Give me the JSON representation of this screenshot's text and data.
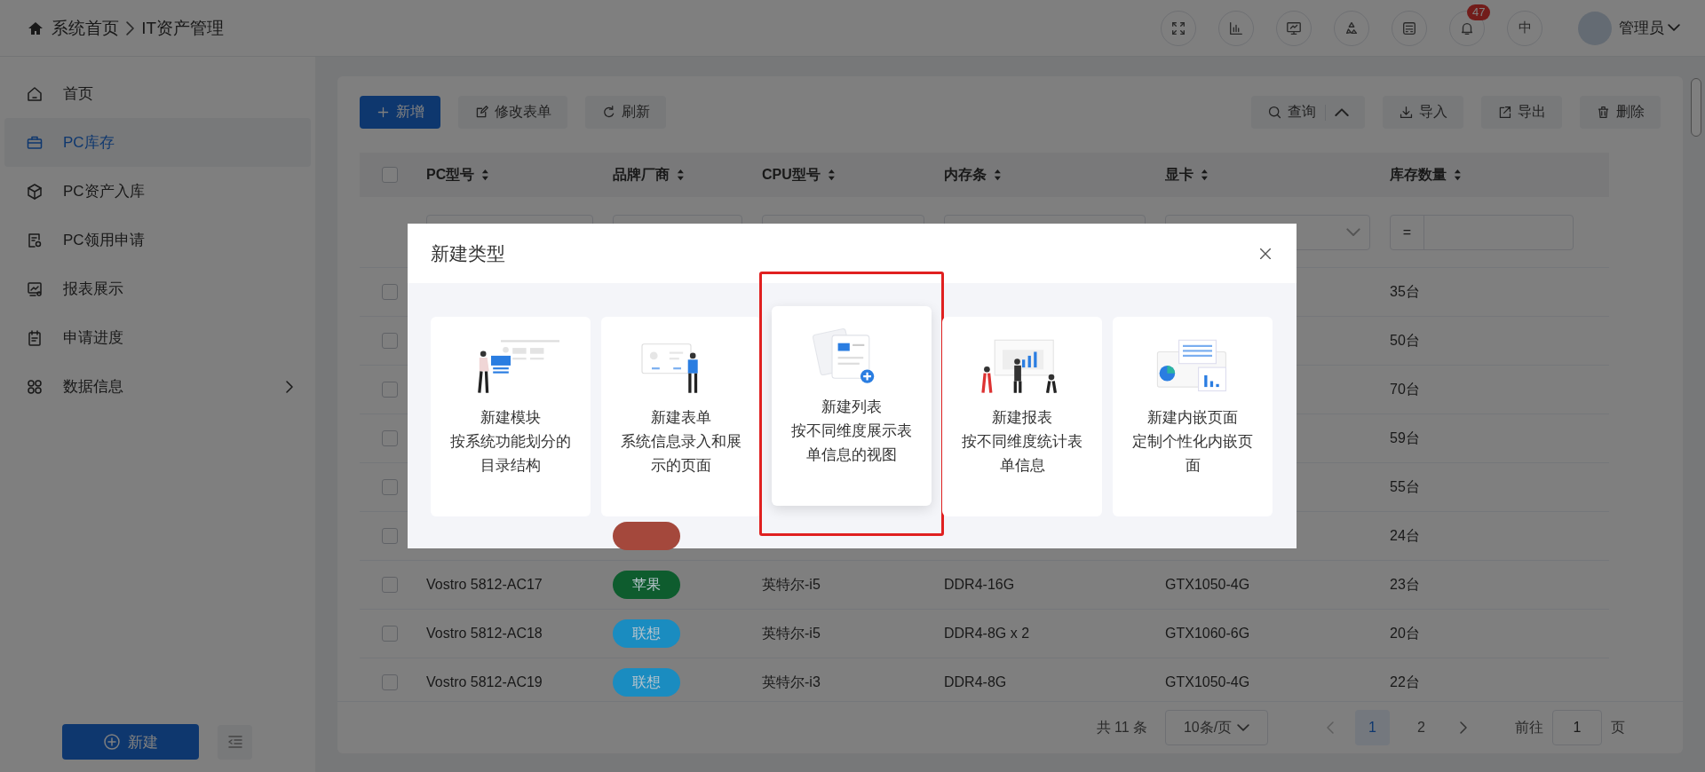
{
  "topbar": {
    "breadcrumb": [
      "系统首页",
      "IT资产管理"
    ],
    "tools": [
      {
        "kind": "fullscreen"
      },
      {
        "kind": "chart"
      },
      {
        "kind": "monitor"
      },
      {
        "kind": "cycle"
      },
      {
        "kind": "calc"
      },
      {
        "kind": "bell",
        "badge": "47"
      },
      {
        "kind": "lang",
        "label": "中"
      }
    ],
    "user": {
      "name": "管理员"
    }
  },
  "sidebar": {
    "items": [
      {
        "label": "首页",
        "kind": "home",
        "selected": false,
        "expandable": false
      },
      {
        "label": "PC库存",
        "kind": "case",
        "selected": true,
        "expandable": false
      },
      {
        "label": "PC资产入库",
        "kind": "cube",
        "selected": false,
        "expandable": false
      },
      {
        "label": "PC领用申请",
        "kind": "doc",
        "selected": false,
        "expandable": false
      },
      {
        "label": "报表展示",
        "kind": "report",
        "selected": false,
        "expandable": false
      },
      {
        "label": "申请进度",
        "kind": "clip",
        "selected": false,
        "expandable": false
      },
      {
        "label": "数据信息",
        "kind": "grid",
        "selected": false,
        "expandable": true
      }
    ],
    "new_button": "新建"
  },
  "toolbar": {
    "left": [
      {
        "label": "新增",
        "kind": "add",
        "primary": true
      },
      {
        "label": "修改表单",
        "kind": "edit",
        "primary": false
      },
      {
        "label": "刷新",
        "kind": "refresh",
        "primary": false
      }
    ],
    "right": [
      {
        "label": "查询",
        "kind": "query",
        "primary": false
      },
      {
        "label": "导入",
        "kind": "import",
        "primary": false
      },
      {
        "label": "导出",
        "kind": "export",
        "primary": false
      },
      {
        "label": "删除",
        "kind": "delete",
        "primary": false
      }
    ]
  },
  "table": {
    "all_checked": false,
    "columns": [
      {
        "label": "PC型号"
      },
      {
        "label": "品牌厂商"
      },
      {
        "label": "CPU型号"
      },
      {
        "label": "内存条"
      },
      {
        "label": "显卡"
      },
      {
        "label": "库存数量"
      }
    ],
    "filters": [
      {
        "kind": "text"
      },
      {
        "kind": "text"
      },
      {
        "kind": "text"
      },
      {
        "kind": "text"
      },
      {
        "kind": "select"
      },
      {
        "kind": "compare",
        "operator": "="
      }
    ],
    "rows": [
      {
        "checked": false,
        "qty": "35台"
      },
      {
        "checked": false,
        "qty": "50台"
      },
      {
        "checked": false,
        "qty": "70台"
      },
      {
        "checked": false,
        "qty": "59台"
      },
      {
        "checked": false,
        "qty": "55台"
      },
      {
        "checked": false,
        "brand": {
          "color": "#a4483c"
        },
        "qty": "24台"
      },
      {
        "checked": false,
        "model": "Vostro 5812-AC17",
        "brand": {
          "label": "苹果",
          "color": "#0e5c2e"
        },
        "cpu": "英特尔-i5",
        "memory": "DDR4-16G",
        "gpu": "GTX1050-4G",
        "qty": "23台"
      },
      {
        "checked": false,
        "model": "Vostro 5812-AC18",
        "brand": {
          "label": "联想",
          "color": "#1a8cc0"
        },
        "cpu": "英特尔-i5",
        "memory": "DDR4-8G x 2",
        "gpu": "GTX1060-6G",
        "qty": "20台"
      },
      {
        "checked": false,
        "model": "Vostro 5812-AC19",
        "brand": {
          "label": "联想",
          "color": "#1a8cc0"
        },
        "cpu": "英特尔-i3",
        "memory": "DDR4-8G",
        "gpu": "GTX1050-4G",
        "qty": "22台"
      }
    ]
  },
  "pagination": {
    "total": "共 11 条",
    "page_size": "10条/页",
    "pages": [
      {
        "label": "1",
        "selected": true
      },
      {
        "label": "2",
        "selected": false
      }
    ],
    "goto_label": "前往",
    "goto_value": "1",
    "goto_suffix": "页"
  },
  "modal": {
    "title": "新建类型",
    "cards": [
      {
        "kind": "module",
        "title": "新建模块",
        "description": "按系统功能划分的目录结构",
        "selected": false
      },
      {
        "kind": "form",
        "title": "新建表单",
        "description": "系统信息录入和展示的页面",
        "selected": false
      },
      {
        "kind": "list",
        "title": "新建列表",
        "description": "按不同维度展示表单信息的视图",
        "selected": true
      },
      {
        "kind": "report",
        "title": "新建报表",
        "description": "按不同维度统计表单信息",
        "selected": false
      },
      {
        "kind": "embed",
        "title": "新建内嵌页面",
        "description": "定制个性化内嵌页面",
        "selected": false
      }
    ]
  }
}
